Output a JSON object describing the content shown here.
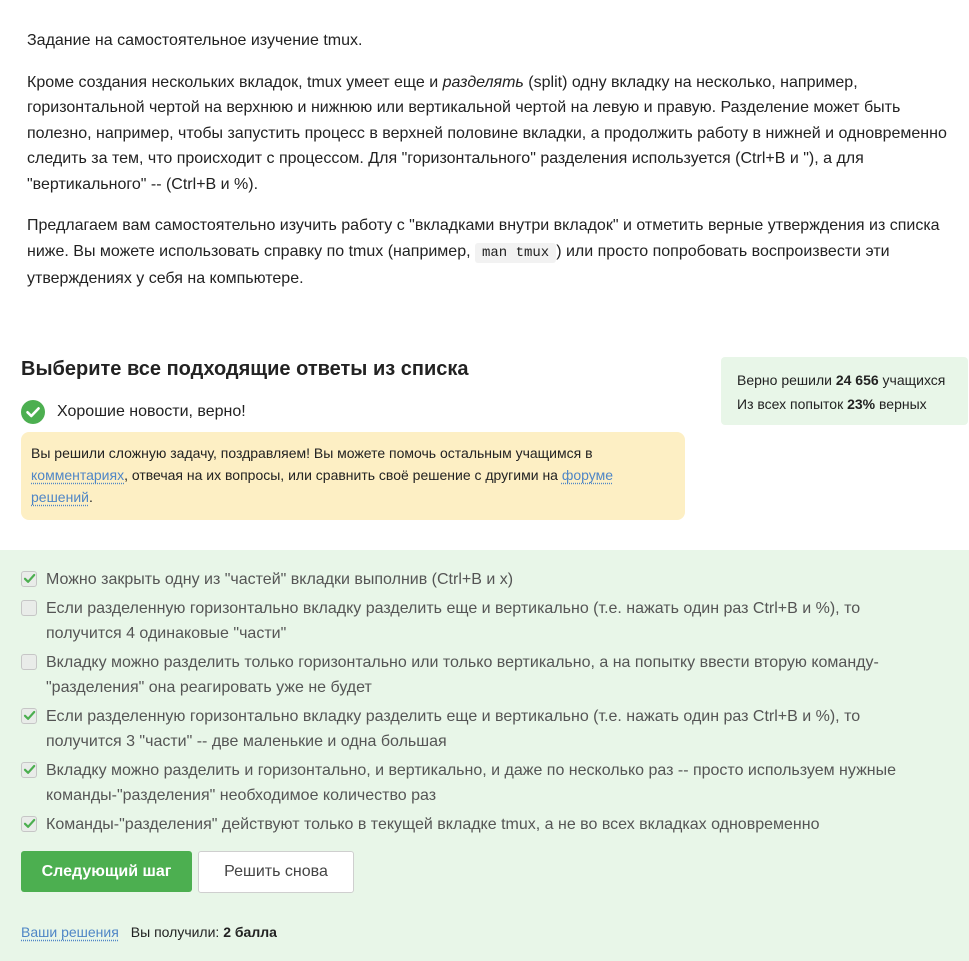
{
  "task": {
    "title": "Задание на самостоятельное изучение tmux.",
    "p1_a": "Кроме создания нескольких вкладок, tmux умеет еще и ",
    "p1_em": "разделять",
    "p1_b": " (split) одну вкладку на несколько, например, горизонтальной чертой на верхнюю и нижнюю или вертикальной чертой на левую и правую. Разделение может быть полезно, например, чтобы запустить процесс в верхней половине вкладки, а продолжить работу в нижней и одновременно следить за тем, что происходит с процессом. Для \"горизонтального\" разделения используется (Ctrl+B и \"), а для \"вертикального\" -- (Ctrl+B и %).",
    "p2_a": "Предлагаем вам самостоятельно изучить работу с \"вкладками внутри вкладок\" и отметить верные утверждения из списка ниже. Вы можете использовать справку по tmux (например, ",
    "p2_code": "man tmux",
    "p2_b": ") или просто попробовать воспроизвести эти утверждениях у себя на компьютере."
  },
  "quiz": {
    "title": "Выберите все подходящие ответы из списка",
    "verdict": "Хорошие новости, верно!",
    "check_icon": "check-circle-icon",
    "success_color": "#4caf50"
  },
  "stats": {
    "solved_prefix": "Верно решили ",
    "solved_count": "24 656",
    "solved_suffix": " учащихся",
    "attempts_prefix": "Из всех попыток ",
    "attempts_pct": "23%",
    "attempts_suffix": " верных"
  },
  "notice": {
    "text_a": "Вы решили сложную задачу, поздравляем! Вы можете помочь остальным учащимся в ",
    "link_comments": "комментариях",
    "text_b": ", отвечая на их вопросы, или сравнить своё решение с другими на ",
    "link_forum": "форуме решений",
    "text_c": "."
  },
  "options": [
    {
      "text": "Можно закрыть одну из \"частей\" вкладки выполнив (Ctrl+B и x)",
      "checked": true
    },
    {
      "text": "Если разделенную горизонтально вкладку разделить еще и вертикально (т.е. нажать один раз Ctrl+B и %), то получится 4 одинаковые \"части\"",
      "checked": false
    },
    {
      "text": "Вкладку можно разделить только горизонтально или только вертикально, а на попытку ввести вторую команду-\"разделения\" она реагировать уже не будет",
      "checked": false
    },
    {
      "text": "Если разделенную горизонтально вкладку разделить еще и вертикально (т.е. нажать один раз Ctrl+B и %), то получится 3 \"части\" -- две маленькие и одна большая",
      "checked": true
    },
    {
      "text": "Вкладку можно разделить и горизонтально, и вертикально, и даже по несколько раз -- просто используем нужные команды-\"разделения\" необходимое количество раз",
      "checked": true
    },
    {
      "text": "Команды-\"разделения\" действуют только в текущей вкладке tmux, а не во всех вкладках одновременно",
      "checked": true
    }
  ],
  "buttons": {
    "next": "Следующий шаг",
    "retry": "Решить снова"
  },
  "footer": {
    "solutions_link": "Ваши решения",
    "score_prefix": "Вы получили: ",
    "score_value": "2 балла"
  }
}
